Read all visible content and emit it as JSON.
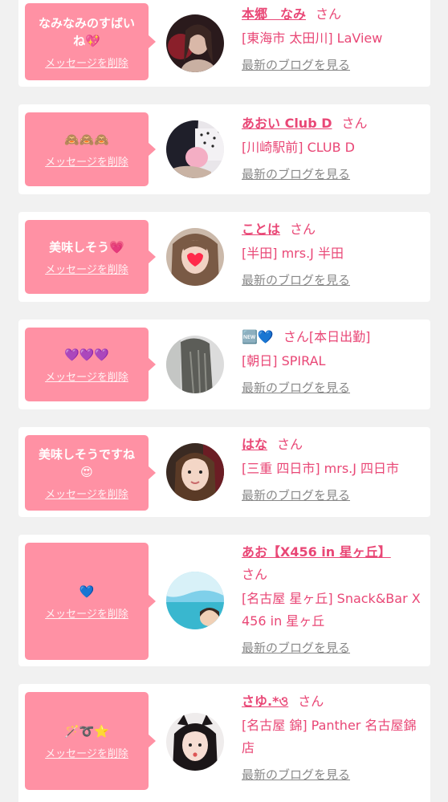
{
  "delete_label": "メッセージを削除",
  "blog_label": "最新のブログを見る",
  "san_label": "さん",
  "cards": [
    {
      "message": "なみなみのすばい\nね💖",
      "name": "本郷　なみ",
      "shop": "[東海市 太田川] LaView"
    },
    {
      "message": "🙈🙈🙈",
      "name": "あおい Club D",
      "shop": "[川崎駅前] CLUB D"
    },
    {
      "message": "美味しそう💗",
      "name": "ことは",
      "shop": "[半田] mrs.J 半田"
    },
    {
      "message": "💜💜💜",
      "name": "🆕💙",
      "extra": "[本日出勤]",
      "shop": "[朝日] SPIRAL"
    },
    {
      "message": "美味しそうですね\n😍",
      "name": "はな",
      "shop": "[三重 四日市] mrs.J 四日市"
    },
    {
      "message": "💙",
      "name": "あお【X456 in 星ヶ丘】",
      "shop": "[名古屋 星ヶ丘] Snack&Bar X 456 in 星ヶ丘"
    },
    {
      "message": "🪄➰⭐",
      "name": "さゆ.*ও",
      "shop": "[名古屋 錦] Panther 名古屋錦店"
    }
  ],
  "colors": {
    "accent": "#e94776",
    "bubble": "#ff91a4",
    "background": "#f1f1f1"
  }
}
